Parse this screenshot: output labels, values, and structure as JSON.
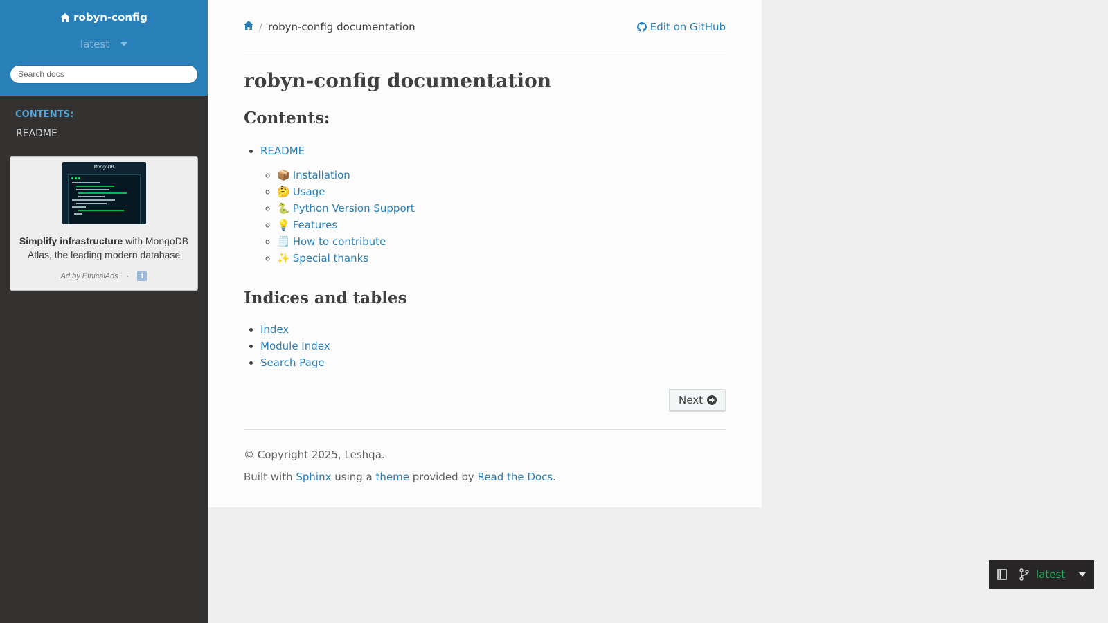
{
  "sidebar": {
    "project_name": "robyn-config",
    "version": "latest",
    "search_placeholder": "Search docs",
    "caption": "CONTENTS:",
    "nav_items": [
      {
        "label": "README"
      }
    ]
  },
  "ad": {
    "image_label": "MongoDB",
    "headline": "Simplify infrastructure",
    "body": " with MongoDB Atlas, the leading modern database",
    "footer": "Ad by EthicalAds",
    "separator": "·",
    "info_glyph": "i"
  },
  "breadcrumb": {
    "separator": "/",
    "current": "robyn-config documentation",
    "edit_label": "Edit on GitHub"
  },
  "page": {
    "title": "robyn-config documentation",
    "contents_heading": "Contents:",
    "toc": {
      "root": "README",
      "items": [
        {
          "emoji": "📦",
          "label": "Installation"
        },
        {
          "emoji": "🤔",
          "label": "Usage"
        },
        {
          "emoji": "🐍",
          "label": "Python Version Support"
        },
        {
          "emoji": "💡",
          "label": "Features"
        },
        {
          "emoji": "🗒️",
          "label": "How to contribute"
        },
        {
          "emoji": "✨",
          "label": "Special thanks"
        }
      ]
    },
    "indices_heading": "Indices and tables",
    "indices": [
      {
        "label": "Index"
      },
      {
        "label": "Module Index"
      },
      {
        "label": "Search Page"
      }
    ],
    "next_label": "Next"
  },
  "footer": {
    "copyright": "© Copyright 2025, Leshqa.",
    "built_prefix": "Built with ",
    "sphinx": "Sphinx",
    "using": " using a ",
    "theme": "theme",
    "provided": " provided by ",
    "rtd": "Read the Docs",
    "period": "."
  },
  "badge": {
    "version": "latest"
  },
  "colors": {
    "sidebar_top": "#2980b9",
    "sidebar_bg": "#343131",
    "link": "#2980b9",
    "caption": "#55a5d9",
    "badge_version": "#27ae60"
  }
}
